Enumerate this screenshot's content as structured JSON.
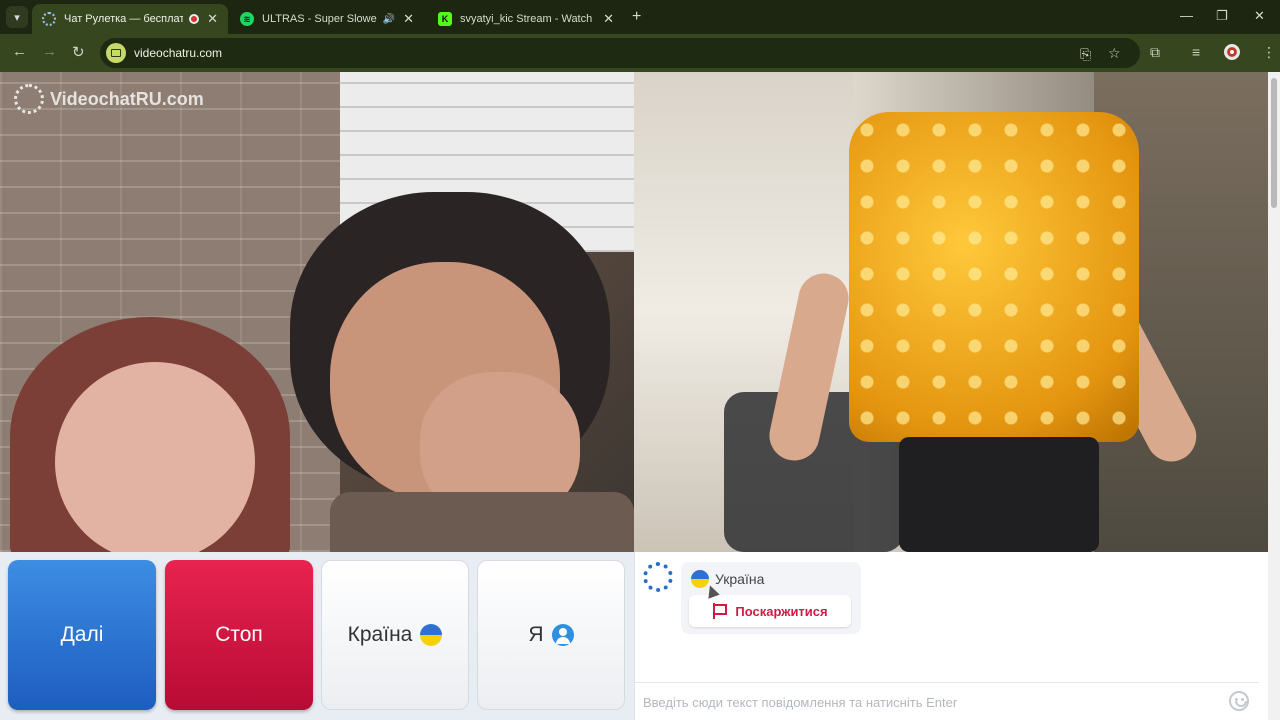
{
  "browser": {
    "tabs": [
      {
        "title": "Чат Рулетка — бесплатный",
        "active": true,
        "recording": true
      },
      {
        "title": "ULTRAS - Super Slowed • S",
        "active": false,
        "audio": true
      },
      {
        "title": "svyatyi_kic Stream - Watch Live",
        "active": false
      }
    ],
    "url": "videochatru.com"
  },
  "video": {
    "watermark": "VideochatRU.com"
  },
  "controls": {
    "next_label": "Далі",
    "stop_label": "Стоп",
    "country_label": "Країна",
    "me_label": "Я"
  },
  "chat": {
    "partner_country": "Україна",
    "report_label": "Поскаржитися",
    "input_placeholder": "Введіть сюди текст повідомлення та натисніть Enter",
    "input_value": ""
  },
  "colors": {
    "next": "#2a72d6",
    "stop": "#d3153f",
    "report": "#d11a45"
  }
}
